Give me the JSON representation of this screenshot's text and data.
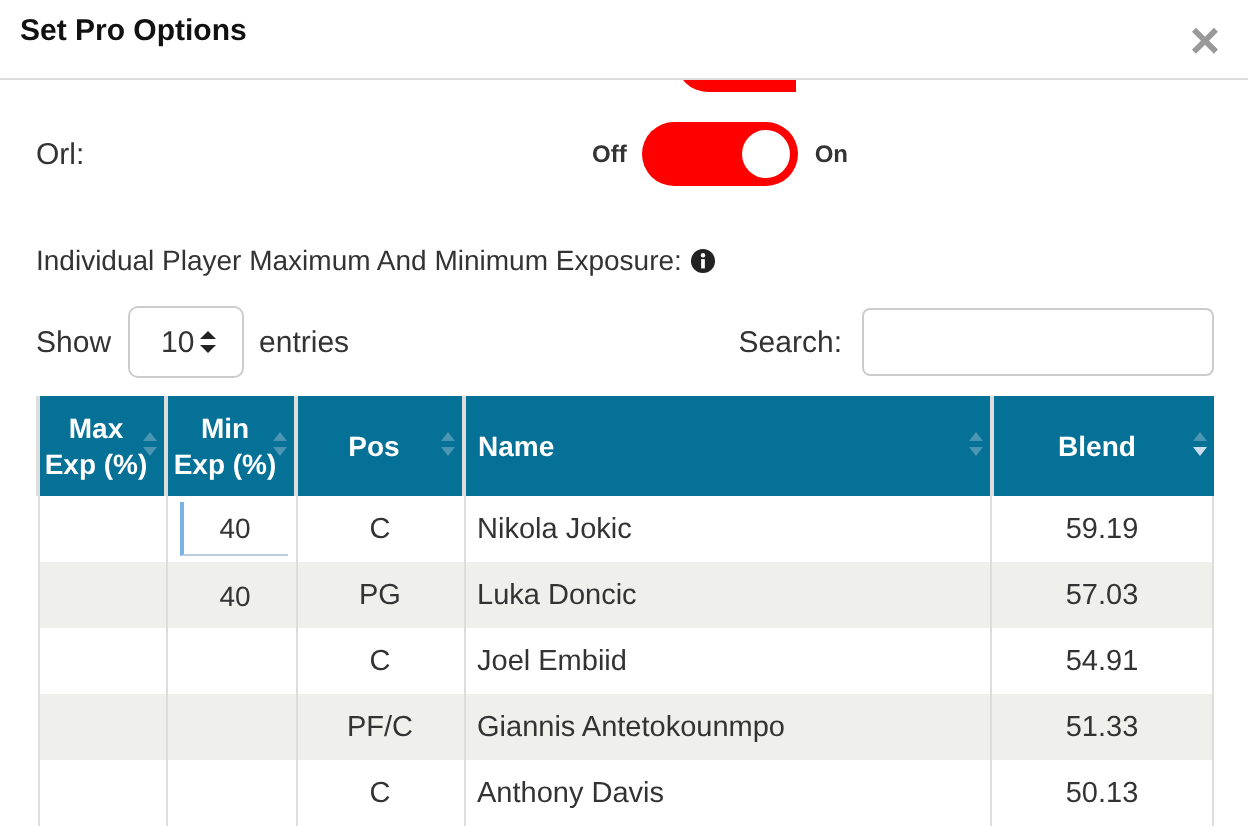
{
  "dialog": {
    "title": "Set Pro Options",
    "close": "×"
  },
  "partial_toggle": {
    "on": true
  },
  "toggle_row": {
    "label": "Orl:",
    "off_label": "Off",
    "on_label": "On",
    "on": true
  },
  "exposure_heading": "Individual Player Maximum And Minimum Exposure:",
  "length": {
    "label_before": "Show",
    "value": "10",
    "label_after": "entries"
  },
  "search": {
    "label": "Search:"
  },
  "table": {
    "columns": [
      {
        "label": "Max Exp (%)",
        "sorted": false
      },
      {
        "label": "Min Exp (%)",
        "sorted": false
      },
      {
        "label": "Pos",
        "sorted": false
      },
      {
        "label": "Name",
        "sorted": false
      },
      {
        "label": "Blend",
        "sorted": true
      }
    ],
    "rows": [
      {
        "min_exp": "40",
        "focused": true,
        "pos": "C",
        "name": "Nikola Jokic",
        "blend": "59.19"
      },
      {
        "min_exp": "40",
        "focused": false,
        "pos": "PG",
        "name": "Luka Doncic",
        "blend": "57.03"
      },
      {
        "pos": "C",
        "name": "Joel Embiid",
        "blend": "54.91"
      },
      {
        "pos": "PF/C",
        "name": "Giannis Antetokounmpo",
        "blend": "51.33"
      },
      {
        "pos": "C",
        "name": "Anthony Davis",
        "blend": "50.13"
      }
    ]
  }
}
